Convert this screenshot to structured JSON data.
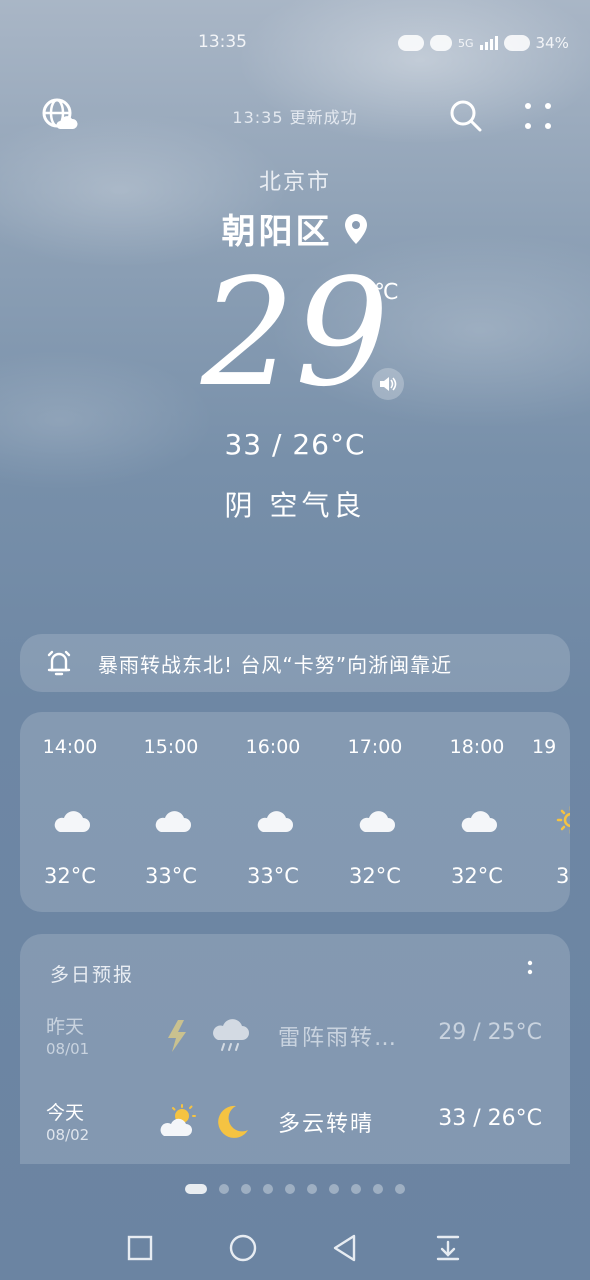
{
  "status_bar": {
    "time": "13:35",
    "network": "5G",
    "battery": "34%"
  },
  "header": {
    "update_text": "13:35 更新成功",
    "icons": [
      "globe-cloud-icon",
      "search-icon",
      "more-grid-icon"
    ]
  },
  "location": {
    "city": "北京市",
    "district": "朝阳区",
    "location_icon": "location-pin-icon"
  },
  "current": {
    "temperature": "29",
    "unit": "℃",
    "range": "33 / 26°C",
    "condition": "阴 空气良"
  },
  "alert": {
    "icon": "alarm-bell-icon",
    "text": "暴雨转战东北! 台风“卡努”向浙闽靠近"
  },
  "hourly": [
    {
      "time": "14:00",
      "icon": "cloudy-icon",
      "temp": "32°C"
    },
    {
      "time": "15:00",
      "icon": "cloudy-icon",
      "temp": "33°C"
    },
    {
      "time": "16:00",
      "icon": "cloudy-icon",
      "temp": "33°C"
    },
    {
      "time": "17:00",
      "icon": "cloudy-icon",
      "temp": "32°C"
    },
    {
      "time": "18:00",
      "icon": "cloudy-icon",
      "temp": "32°C"
    },
    {
      "time": "19",
      "icon": "sun-icon",
      "temp": "3"
    }
  ],
  "daily": {
    "title": "多日预报",
    "days": [
      {
        "name": "昨天",
        "date": "08/01",
        "icons": [
          "thunder-icon",
          "rain-cloud-icon"
        ],
        "desc": "雷阵雨转…",
        "temp": "29 / 25°C"
      },
      {
        "name": "今天",
        "date": "08/02",
        "icons": [
          "partly-cloudy-icon",
          "moon-icon"
        ],
        "desc": "多云转晴",
        "temp": "33 / 26°C"
      }
    ]
  },
  "pages": {
    "count": 10,
    "active": 0
  },
  "colors": {
    "sun": "#f5c342",
    "moon": "#f5c342",
    "thunder": "#d6c88a"
  }
}
